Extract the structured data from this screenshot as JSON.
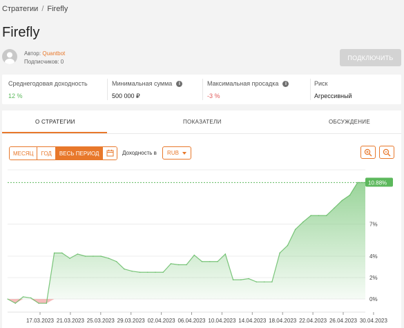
{
  "breadcrumb": {
    "parent": "Стратегии",
    "separator": "/",
    "current": "Firefly"
  },
  "strategy": {
    "title": "Firefly",
    "author_prefix": "Автор:",
    "author_name": "Quantbot",
    "subscribers_label": "Подписчиков: 0",
    "connect_label": "ПОДКЛЮЧИТЬ"
  },
  "metrics": {
    "annual_yield": {
      "label": "Среднегодовая доходность",
      "value": "12 %"
    },
    "min_sum": {
      "label": "Минимальная сумма",
      "value": "500 000 ₽"
    },
    "max_drawdown": {
      "label": "Максимальная просадка",
      "value": "-3 %"
    },
    "risk": {
      "label": "Риск",
      "value": "Агрессивный"
    }
  },
  "tabs": [
    "О СТРАТЕГИИ",
    "ПОКАЗАТЕЛИ",
    "ОБСУЖДЕНИЕ"
  ],
  "controls": {
    "periods": [
      "МЕСЯЦ",
      "ГОД",
      "ВЕСЬ ПЕРИОД"
    ],
    "active_period": "ВЕСЬ ПЕРИОД",
    "yield_label": "Доходность в",
    "currency": "RUB"
  },
  "icons": {
    "calendar": "calendar-icon",
    "zoom_in": "zoom-in-icon",
    "zoom_out": "zoom-out-icon",
    "info": "info-icon"
  },
  "colors": {
    "accent": "#e8782b",
    "positive": "#5cb85c",
    "negative": "#e05a5a",
    "area_top": "#8fd08f",
    "area_negative": "#f2a0a0"
  },
  "chart_data": {
    "type": "area",
    "x_tick_labels": [
      "17.03.2023",
      "21.03.2023",
      "25.03.2023",
      "29.03.2023",
      "02.04.2023",
      "06.04.2023",
      "10.04.2023",
      "14.04.2023",
      "18.04.2023",
      "22.04.2023",
      "26.04.2023",
      "30.04.2023"
    ],
    "y_tick_labels": [
      "0%",
      "2%",
      "4%",
      "7%"
    ],
    "y_ticks": [
      0,
      2,
      4,
      7
    ],
    "current_value_label": "10.88%",
    "current_value": 10.88,
    "ylim": [
      -0.6,
      11.5
    ],
    "grid": true,
    "dates": [
      "2023-03-15",
      "2023-03-16",
      "2023-03-17",
      "2023-03-18",
      "2023-03-19",
      "2023-03-20",
      "2023-03-21",
      "2023-03-22",
      "2023-03-23",
      "2023-03-24",
      "2023-03-25",
      "2023-03-26",
      "2023-03-27",
      "2023-03-28",
      "2023-03-29",
      "2023-03-30",
      "2023-03-31",
      "2023-04-01",
      "2023-04-02",
      "2023-04-03",
      "2023-04-04",
      "2023-04-05",
      "2023-04-06",
      "2023-04-07",
      "2023-04-08",
      "2023-04-09",
      "2023-04-10",
      "2023-04-11",
      "2023-04-12",
      "2023-04-13",
      "2023-04-14",
      "2023-04-15",
      "2023-04-16",
      "2023-04-17",
      "2023-04-18",
      "2023-04-19",
      "2023-04-20",
      "2023-04-21",
      "2023-04-22",
      "2023-04-23",
      "2023-04-24",
      "2023-04-25",
      "2023-04-26",
      "2023-04-27",
      "2023-04-28",
      "2023-04-29",
      "2023-04-30"
    ],
    "values": [
      0.0,
      -0.4,
      0.2,
      0.1,
      -0.4,
      -0.4,
      4.3,
      4.3,
      3.8,
      4.2,
      4.0,
      4.0,
      4.0,
      3.8,
      3.5,
      2.8,
      2.6,
      2.5,
      2.5,
      2.5,
      2.5,
      3.3,
      3.2,
      3.2,
      4.1,
      3.5,
      3.5,
      3.5,
      4.2,
      1.8,
      1.8,
      1.9,
      1.6,
      1.6,
      1.6,
      4.3,
      5.0,
      6.5,
      7.2,
      7.8,
      7.8,
      7.8,
      8.5,
      9.2,
      9.7,
      10.88,
      10.88
    ]
  }
}
